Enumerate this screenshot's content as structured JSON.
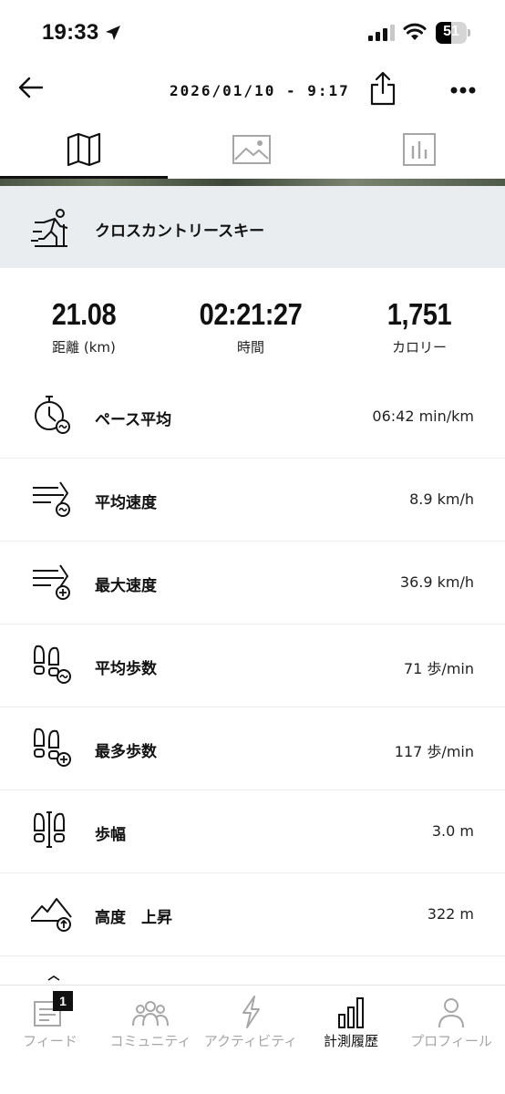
{
  "status_bar": {
    "time": "19:33",
    "battery_percent": 51,
    "battery_label": "51"
  },
  "header": {
    "title": "2026/01/10 - 9:17",
    "tabs": [
      {
        "icon": "map-icon",
        "active": true
      },
      {
        "icon": "image-icon",
        "active": false
      },
      {
        "icon": "chart-icon",
        "active": false
      }
    ]
  },
  "activity": {
    "name": "クロスカントリースキー",
    "icon": "cross-country-ski-icon"
  },
  "summary": [
    {
      "value": "21.08",
      "label": "距離 (km)"
    },
    {
      "value": "02:21:27",
      "label": "時間"
    },
    {
      "value": "1,751",
      "label": "カロリー"
    }
  ],
  "metrics": [
    {
      "label": "ペース平均",
      "value": "06:42 min/km",
      "icon": "stopwatch-average-icon"
    },
    {
      "label": "平均速度",
      "value": "8.9 km/h",
      "icon": "speed-average-icon"
    },
    {
      "label": "最大速度",
      "value": "36.9 km/h",
      "icon": "speed-max-icon"
    },
    {
      "label": "平均歩数",
      "value": "71 歩/min",
      "icon": "steps-average-icon"
    },
    {
      "label": "最多歩数",
      "value": "117 歩/min",
      "icon": "steps-max-icon"
    },
    {
      "label": "歩幅",
      "value": "3.0 m",
      "icon": "stride-icon"
    },
    {
      "label": "高度　上昇",
      "value": "322 m",
      "icon": "elevation-gain-icon"
    }
  ],
  "bottom_nav": [
    {
      "label": "フィード",
      "icon": "feed-icon",
      "badge": "1",
      "active": false
    },
    {
      "label": "コミュニティ",
      "icon": "community-icon",
      "active": false
    },
    {
      "label": "アクティビティ",
      "icon": "activity-bolt-icon",
      "active": false
    },
    {
      "label": "計測履歴",
      "icon": "history-bars-icon",
      "active": true
    },
    {
      "label": "プロフィール",
      "icon": "profile-icon",
      "active": false
    }
  ],
  "colors": {
    "banner_bg": "#eaedef",
    "inactive": "#a6a6a6",
    "text": "#111111"
  }
}
